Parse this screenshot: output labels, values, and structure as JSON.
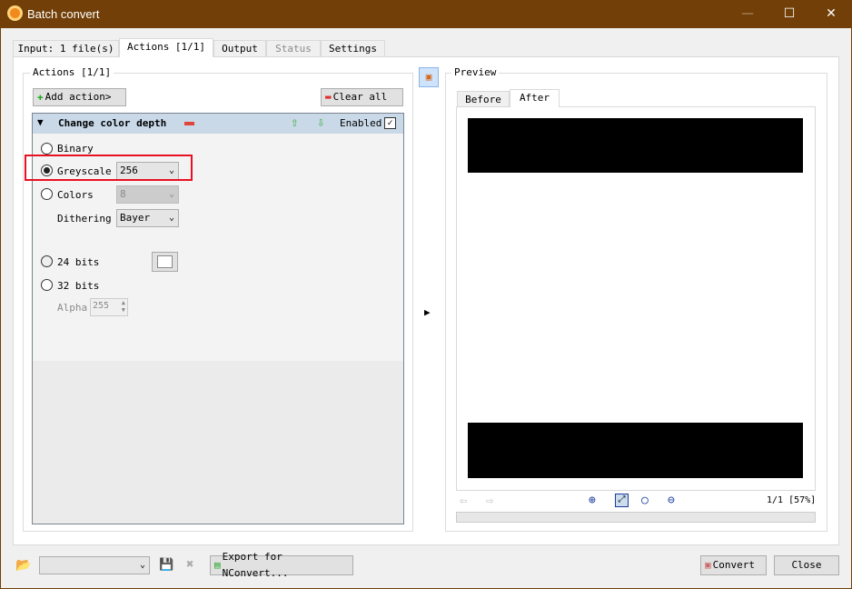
{
  "window": {
    "title": "Batch convert",
    "min": "—",
    "max": "☐",
    "close": "✕"
  },
  "tabs": [
    "Input: 1 file(s)",
    "Actions [1/1]",
    "Output",
    "Status",
    "Settings"
  ],
  "actions": {
    "group_label": "Actions [1/1]",
    "add_action": "Add action>",
    "clear_all": "Clear all",
    "item": {
      "title": "Change color depth",
      "enabled_label": "Enabled",
      "enabled": true,
      "options": {
        "binary": "Binary",
        "greyscale": "Greyscale",
        "greyscale_value": "256",
        "colors": "Colors",
        "colors_value": "8",
        "dithering": "Dithering",
        "dithering_value": "Bayer",
        "bits24": "24 bits",
        "bits32": "32 bits",
        "alpha": "Alpha",
        "alpha_value": "255"
      },
      "selected": "greyscale"
    }
  },
  "preview": {
    "group_label": "Preview",
    "tabs": [
      "Before",
      "After"
    ],
    "active_tab": "After",
    "page_info": "1/1 [57%]"
  },
  "bottom": {
    "export": "Export for NConvert...",
    "convert": "Convert",
    "close": "Close",
    "preset_value": ""
  },
  "colors": {
    "titlebar": "#713f07",
    "highlight": "#e81123"
  }
}
